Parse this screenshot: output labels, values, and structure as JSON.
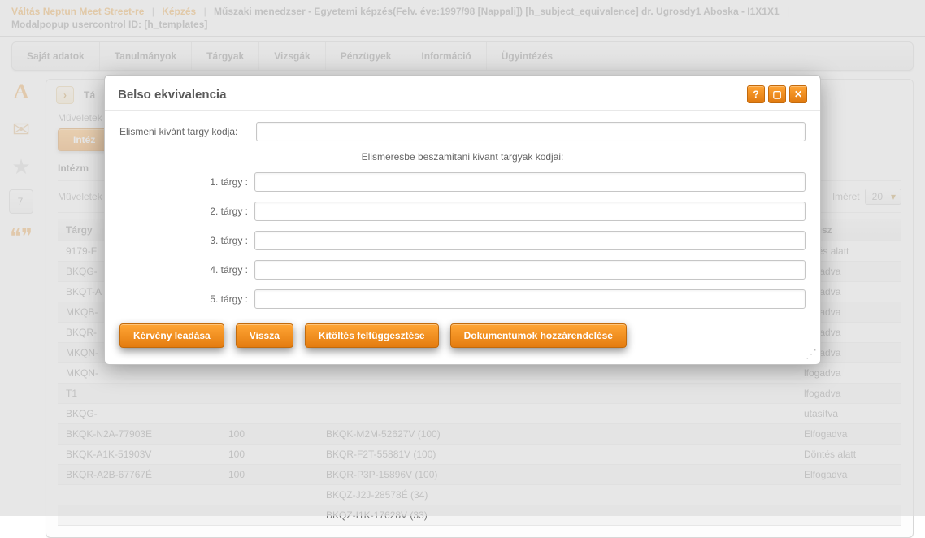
{
  "top": {
    "link1": "Váltás Neptun Meet Street-re",
    "link2": "Képzés",
    "desc": "Műszaki menedzser - Egyetemi képzés(Felv. éve:1997/98 [Nappali]) [h_subject_equivalence] dr. Ugrosdy1 Aboska - I1X1X1",
    "line2": "Modalpopup usercontrol ID: [h_templates]"
  },
  "menu": [
    "Saját adatok",
    "Tanulmányok",
    "Tárgyak",
    "Vizsgák",
    "Pénzügyek",
    "Információ",
    "Ügyintézés"
  ],
  "dock_icons": [
    "letter-A",
    "envelope",
    "star",
    "calendar-7",
    "speech-bubbles"
  ],
  "panel": {
    "title": "Tá",
    "ops": "Műveletek",
    "tab": "Intéz",
    "section": "Intézm",
    "ops2": "Műveletek",
    "page_label": "lméret",
    "page_value": "20"
  },
  "columns": [
    "Tárgy",
    "",
    "",
    "tátusz"
  ],
  "rows": [
    {
      "c1": "9179-F",
      "c2": "",
      "c3": "",
      "c4": "öntés alatt"
    },
    {
      "c1": "BKQG-",
      "c2": "",
      "c3": "",
      "c4": "lfogadva"
    },
    {
      "c1": "BKQT-A",
      "c2": "",
      "c3": "",
      "c4": "lfogadva"
    },
    {
      "c1": "MKQB-",
      "c2": "",
      "c3": "",
      "c4": "lfogadva"
    },
    {
      "c1": "BKQR-",
      "c2": "",
      "c3": "",
      "c4": "lfogadva"
    },
    {
      "c1": "MKQN-",
      "c2": "",
      "c3": "",
      "c4": "lfogadva"
    },
    {
      "c1": "MKQN-",
      "c2": "",
      "c3": "",
      "c4": "lfogadva"
    },
    {
      "c1": "T1",
      "c2": "",
      "c3": "",
      "c4": "lfogadva"
    },
    {
      "c1": "BKQG-",
      "c2": "",
      "c3": "",
      "c4": "utasítva"
    },
    {
      "c1": "BKQK-N2A-77903E",
      "c2": "100",
      "c3": "BKQK-M2M-52627V (100)",
      "c4": "Elfogadva"
    },
    {
      "c1": "BKQK-A1K-51903V",
      "c2": "100",
      "c3": "BKQR-F2T-55881V (100)",
      "c4": "Döntés alatt"
    },
    {
      "c1": "BKQR-A2B-67767É",
      "c2": "100",
      "c3": "BKQR-P3P-15896V (100)",
      "c4": "Elfogadva"
    },
    {
      "c1": "",
      "c2": "",
      "c3": "BKQZ-J2J-28578É (34)",
      "c4": ""
    },
    {
      "c1": "",
      "c2": "",
      "c3": "BKQZ-I1K-17628V (33)",
      "c4": ""
    }
  ],
  "modal": {
    "title": "Belso ekvivalencia",
    "code_label": "Elismeni kivánt targy kodja:",
    "sub": "Elismeresbe beszamitani kivant targyak kodjai:",
    "fields": [
      "1. tárgy :",
      "2. tárgy :",
      "3. tárgy :",
      "4. tárgy :",
      "5. tárgy :"
    ],
    "buttons": {
      "submit": "Kérvény leadása",
      "back": "Vissza",
      "suspend": "Kitöltés felfüggesztése",
      "docs": "Dokumentumok hozzárendelése"
    }
  }
}
